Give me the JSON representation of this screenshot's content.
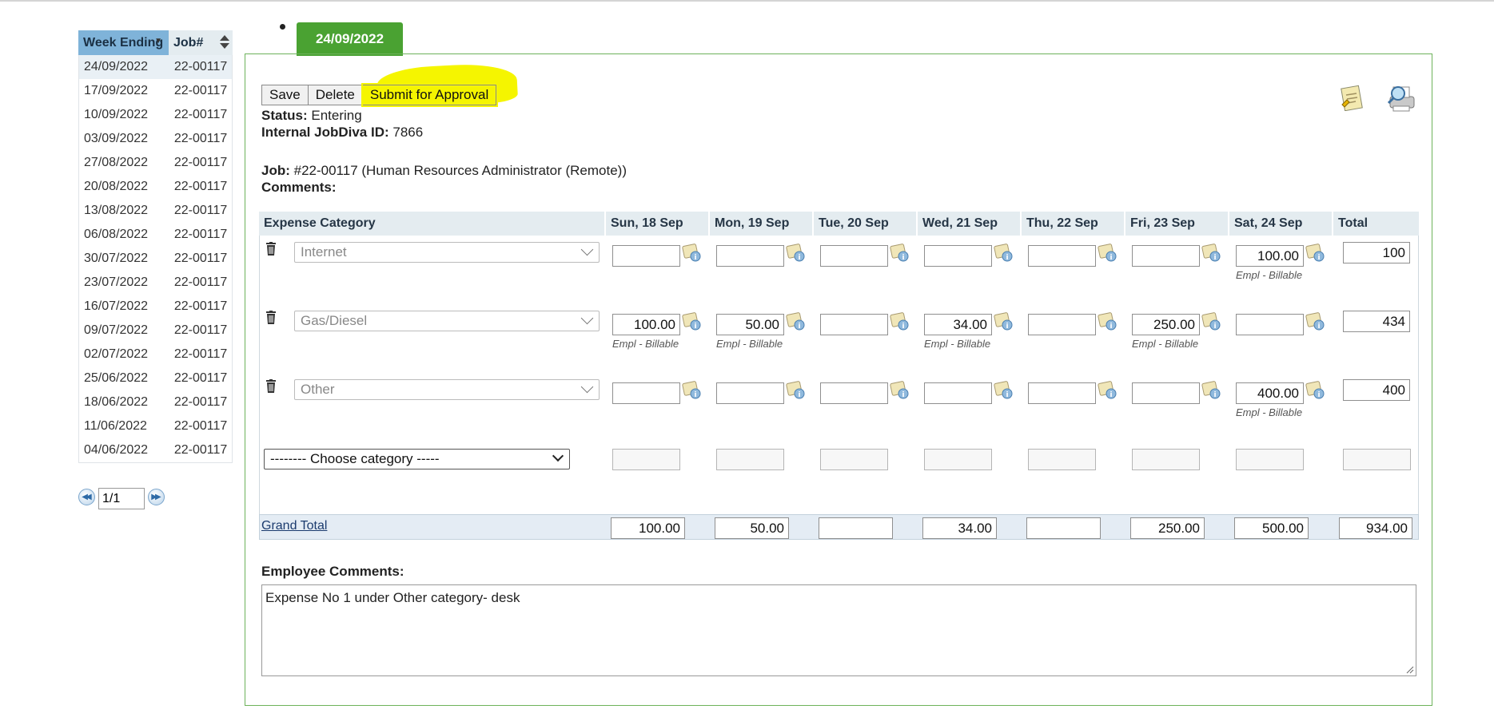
{
  "week_list": {
    "headers": {
      "week": "Week Ending",
      "job": "Job#"
    },
    "rows": [
      {
        "week": "24/09/2022",
        "job": "22-00117"
      },
      {
        "week": "17/09/2022",
        "job": "22-00117"
      },
      {
        "week": "10/09/2022",
        "job": "22-00117"
      },
      {
        "week": "03/09/2022",
        "job": "22-00117"
      },
      {
        "week": "27/08/2022",
        "job": "22-00117"
      },
      {
        "week": "20/08/2022",
        "job": "22-00117"
      },
      {
        "week": "13/08/2022",
        "job": "22-00117"
      },
      {
        "week": "06/08/2022",
        "job": "22-00117"
      },
      {
        "week": "30/07/2022",
        "job": "22-00117"
      },
      {
        "week": "23/07/2022",
        "job": "22-00117"
      },
      {
        "week": "16/07/2022",
        "job": "22-00117"
      },
      {
        "week": "09/07/2022",
        "job": "22-00117"
      },
      {
        "week": "02/07/2022",
        "job": "22-00117"
      },
      {
        "week": "25/06/2022",
        "job": "22-00117"
      },
      {
        "week": "18/06/2022",
        "job": "22-00117"
      },
      {
        "week": "11/06/2022",
        "job": "22-00117"
      },
      {
        "week": "04/06/2022",
        "job": "22-00117"
      }
    ],
    "pager_value": "1/1"
  },
  "tab": {
    "label": "24/09/2022"
  },
  "toolbar": {
    "save": "Save",
    "delete": "Delete",
    "submit": "Submit for Approval"
  },
  "info": {
    "status_label": "Status:",
    "status_value": "Entering",
    "internal_id_label": "Internal JobDiva ID:",
    "internal_id_value": "7866",
    "job_label": "Job:",
    "job_value": "#22-00117 (Human Resources Administrator (Remote))",
    "comments_label": "Comments:"
  },
  "expense_table": {
    "headers": [
      "Expense Category",
      "Sun, 18 Sep",
      "Mon, 19 Sep",
      "Tue, 20 Sep",
      "Wed, 21 Sep",
      "Thu, 22 Sep",
      "Fri, 23 Sep",
      "Sat, 24 Sep",
      "Total"
    ],
    "rows": [
      {
        "category": "Internet",
        "days": [
          "",
          "",
          "",
          "",
          "",
          "",
          "100.00"
        ],
        "billing": [
          "",
          "",
          "",
          "",
          "",
          "",
          "Empl - Billable"
        ],
        "total": "100"
      },
      {
        "category": "Gas/Diesel",
        "days": [
          "100.00",
          "50.00",
          "",
          "34.00",
          "",
          "250.00",
          ""
        ],
        "billing": [
          "Empl - Billable",
          "Empl - Billable",
          "",
          "Empl - Billable",
          "",
          "Empl - Billable",
          ""
        ],
        "total": "434"
      },
      {
        "category": "Other",
        "days": [
          "",
          "",
          "",
          "",
          "",
          "",
          "400.00"
        ],
        "billing": [
          "",
          "",
          "",
          "",
          "",
          "",
          "Empl - Billable"
        ],
        "total": "400"
      }
    ],
    "new_row_placeholder": "-------- Choose category -----",
    "grand_total_label": "Grand Total",
    "grand_totals": [
      "100.00",
      "50.00",
      "",
      "34.00",
      "",
      "250.00",
      "500.00",
      "934.00"
    ]
  },
  "employee_comments": {
    "label": "Employee Comments:",
    "value": "Expense No 1 under Other category- desk"
  },
  "colors": {
    "tab_green": "#4aa232",
    "panel_border": "#6db25a",
    "highlight_yellow": "#f5f500",
    "header_blue": "#7fb3d9"
  },
  "icons": [
    "trash-icon",
    "info-note-icon",
    "notes-icon",
    "print-preview-icon",
    "first-page-icon",
    "last-page-icon"
  ]
}
